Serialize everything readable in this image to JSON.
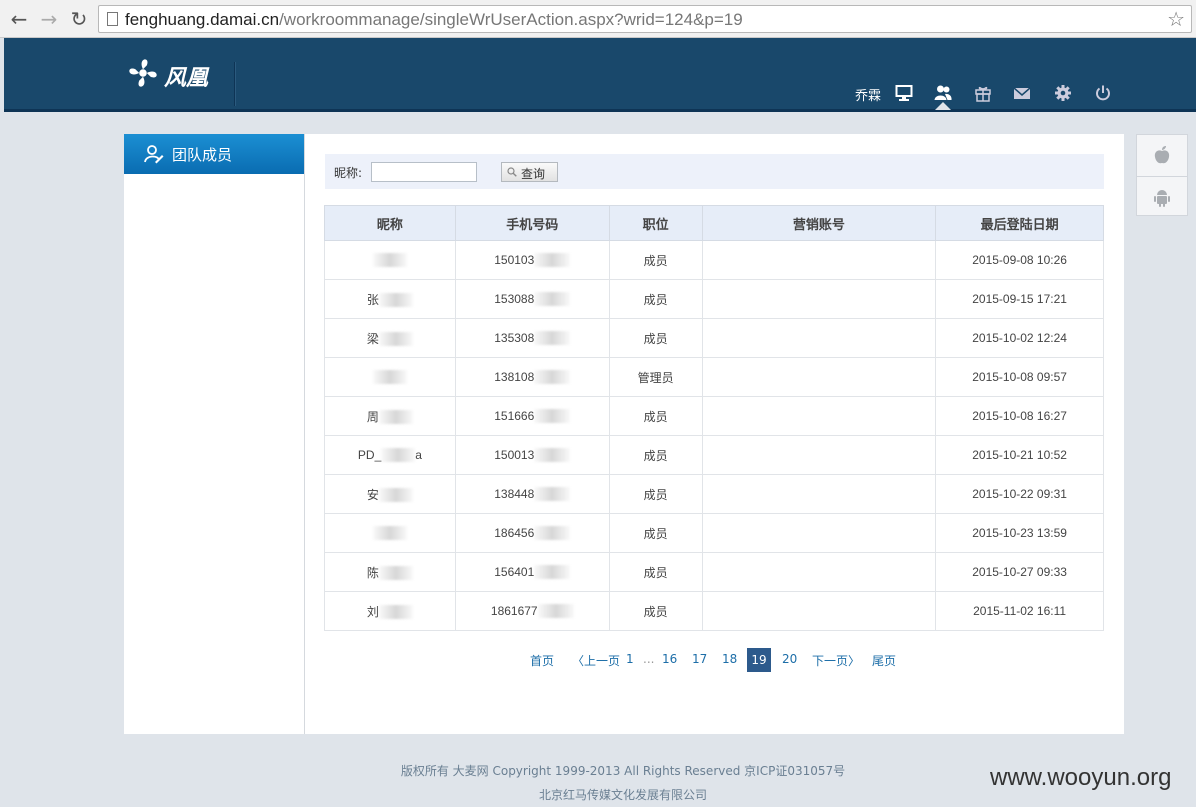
{
  "browser": {
    "url_host": "fenghuang.damai.cn",
    "url_path": "/workroommanage/singleWrUserAction.aspx?wrid=124&p=19"
  },
  "header": {
    "logo_text": "风凰",
    "user_name": "乔霖",
    "icons": [
      "monitor-icon",
      "team-icon",
      "gift-icon",
      "mail-icon",
      "gear-icon",
      "power-icon"
    ]
  },
  "sidebar": {
    "items": [
      {
        "label": "团队成员",
        "active": true
      }
    ]
  },
  "search": {
    "label": "昵称:",
    "value": "",
    "button_label": "查询"
  },
  "table": {
    "headers": [
      "昵称",
      "手机号码",
      "职位",
      "营销账号",
      "最后登陆日期"
    ],
    "rows": [
      {
        "nick": "",
        "nick_suffix": "",
        "phone": "150103",
        "role": "成员",
        "account": "",
        "date": "2015-09-08 10:26"
      },
      {
        "nick": "张",
        "nick_suffix": "",
        "phone": "153088",
        "role": "成员",
        "account": "",
        "date": "2015-09-15 17:21"
      },
      {
        "nick": "梁",
        "nick_suffix": "",
        "phone": "135308",
        "role": "成员",
        "account": "",
        "date": "2015-10-02 12:24"
      },
      {
        "nick": "",
        "nick_suffix": "",
        "phone": "138108",
        "role": "管理员",
        "account": "",
        "date": "2015-10-08 09:57"
      },
      {
        "nick": "周",
        "nick_suffix": "",
        "phone": "151666",
        "role": "成员",
        "account": "",
        "date": "2015-10-08 16:27"
      },
      {
        "nick": "PD_",
        "nick_suffix": "a",
        "phone": "150013",
        "role": "成员",
        "account": "",
        "date": "2015-10-21 10:52"
      },
      {
        "nick": "安",
        "nick_suffix": "",
        "phone": "138448",
        "role": "成员",
        "account": "",
        "date": "2015-10-22 09:31"
      },
      {
        "nick": "",
        "nick_suffix": "",
        "phone": "186456",
        "role": "成员",
        "account": "",
        "date": "2015-10-23 13:59"
      },
      {
        "nick": "陈",
        "nick_suffix": "",
        "phone": "156401",
        "role": "成员",
        "account": "",
        "date": "2015-10-27 09:33"
      },
      {
        "nick": "刘",
        "nick_suffix": "",
        "phone": "1861677",
        "role": "成员",
        "account": "",
        "date": "2015-11-02 16:11"
      }
    ]
  },
  "pager": {
    "first": "首页",
    "prev": "〈上一页",
    "p1": "1",
    "dots": "...",
    "p16": "16",
    "p17": "17",
    "p18": "18",
    "p19": "19",
    "p20": "20",
    "next": "下一页〉",
    "last": "尾页",
    "current": 19
  },
  "footer": {
    "line1": "版权所有 大麦网 Copyright 1999-2013 All Rights Reserved 京ICP证031057号",
    "line2": "北京红马传媒文化发展有限公司"
  },
  "watermark": "www.wooyun.org",
  "colors": {
    "header_bg": "#19486b",
    "sidebar_active": "#0a6cb1",
    "pager_current": "#2d5a8c",
    "link": "#1d6ea8"
  }
}
